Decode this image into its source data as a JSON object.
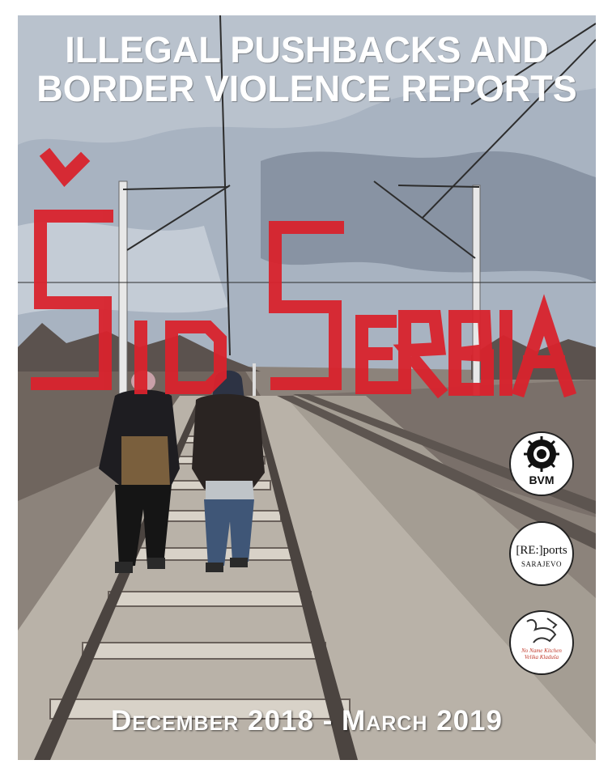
{
  "title": {
    "line1": "ILLEGAL PUSHBACKS AND",
    "line2": "BORDER VIOLENCE REPORTS"
  },
  "graffiti": {
    "text": "ŠID SERBIA",
    "color": "#d9232d"
  },
  "footer": {
    "date_range": "December 2018 - March 2019"
  },
  "logos": {
    "bvm": {
      "label": "BVM"
    },
    "reports": {
      "label": "[RE:]ports",
      "sublabel": "SARAJEVO"
    },
    "no_name_kitchen": {
      "label": "No Name Kitchen Velika Kladuša"
    }
  },
  "colors": {
    "sky": "#a9b4c2",
    "ground": "#8a8179",
    "title": "#ffffff"
  }
}
